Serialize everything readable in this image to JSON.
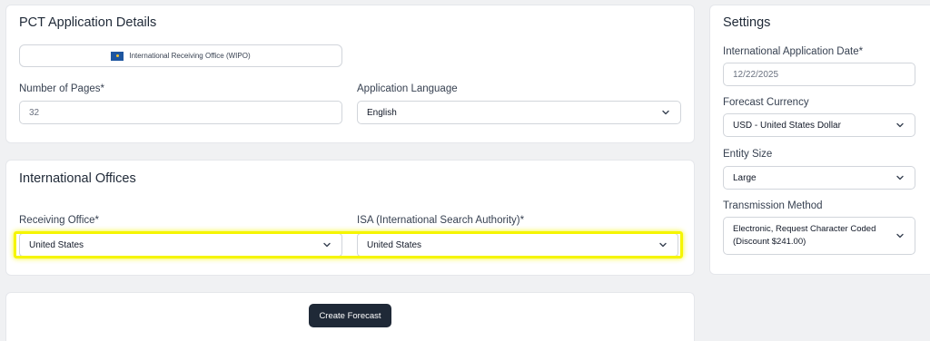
{
  "pct_details": {
    "title": "PCT Application Details",
    "receiving_office_pill": "International Receiving Office (WIPO)",
    "pages_label": "Number of Pages*",
    "pages_value": "32",
    "language_label": "Application Language",
    "language_value": "English"
  },
  "international_offices": {
    "title": "International Offices",
    "receiving_office_label": "Receiving Office*",
    "receiving_office_value": "United States",
    "isa_label": "ISA (International Search Authority)*",
    "isa_value": "United States"
  },
  "actions": {
    "create_forecast": "Create Forecast"
  },
  "settings": {
    "title": "Settings",
    "date_label": "International Application Date*",
    "date_value": "12/22/2025",
    "currency_label": "Forecast Currency",
    "currency_value": "USD - United States Dollar",
    "entity_label": "Entity Size",
    "entity_value": "Large",
    "transmission_label": "Transmission Method",
    "transmission_value": "Electronic, Request Character Coded (Discount $241.00)"
  },
  "colors": {
    "highlight": "#f5f500",
    "button_bg": "#1f2937",
    "page_bg": "#f0f1f3"
  },
  "icons": {
    "select_arrow": "chevron-down-icon",
    "office_flag": "wipo-flag-icon"
  }
}
